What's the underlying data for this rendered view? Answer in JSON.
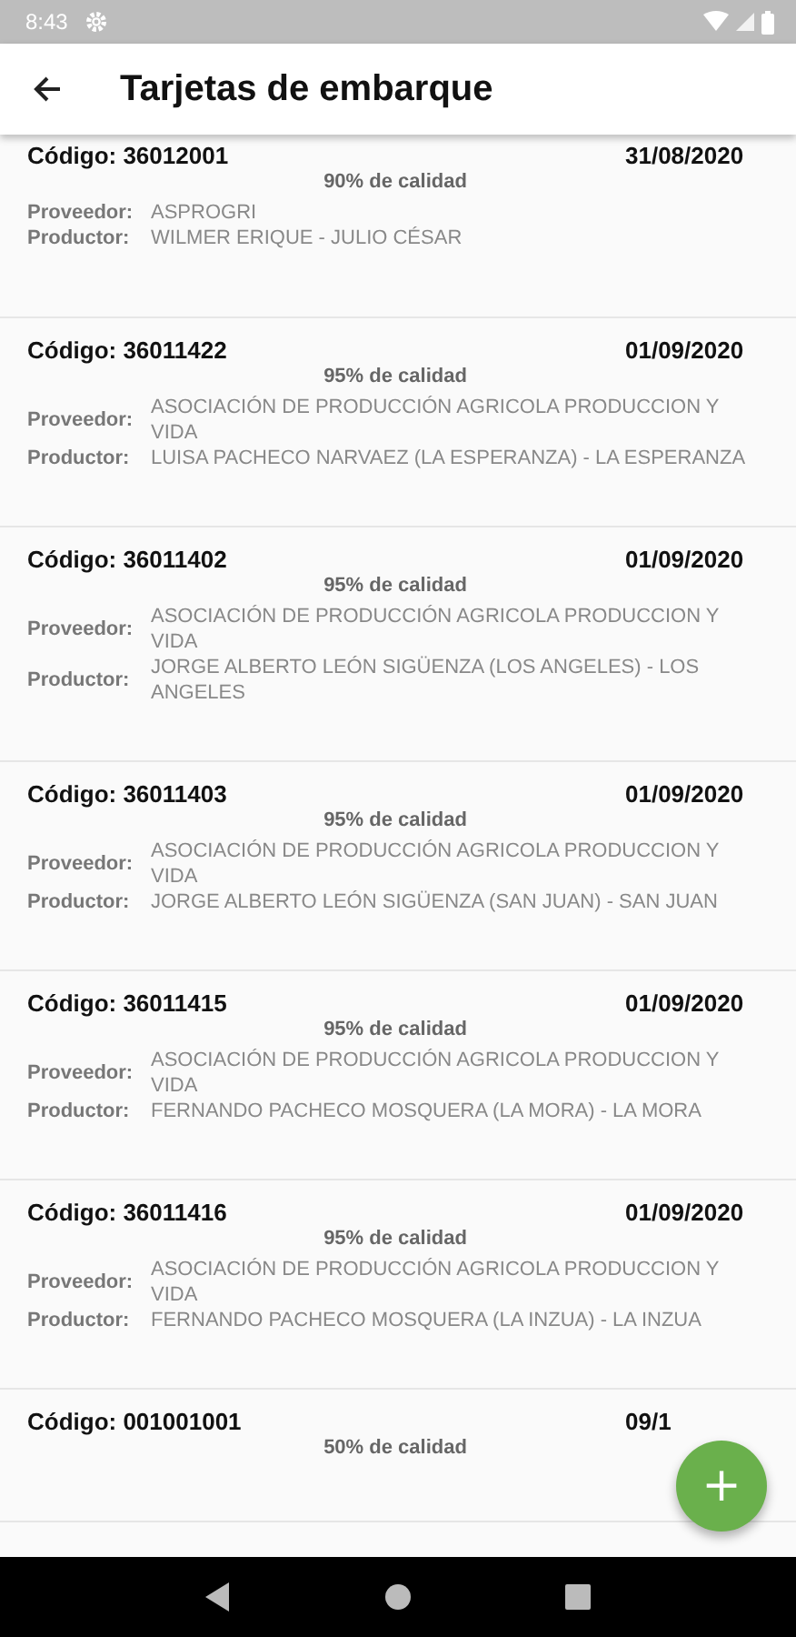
{
  "status_bar": {
    "time": "8:43"
  },
  "app_bar": {
    "title": "Tarjetas de embarque"
  },
  "cards": [
    {
      "code": "Código: 36012001",
      "date": "31/08/2020",
      "quality": "90% de calidad",
      "fields": [
        {
          "label": "Proveedor:",
          "value": "ASPROGRI"
        },
        {
          "label": "Productor:",
          "value": "WILMER ERIQUE - JULIO CÉSAR"
        }
      ]
    },
    {
      "code": "Código: 36011422",
      "date": "01/09/2020",
      "quality": "95% de calidad",
      "fields": [
        {
          "label": "Proveedor:",
          "value": "ASOCIACIÓN DE PRODUCCIÓN AGRICOLA PRODUCCION Y VIDA"
        },
        {
          "label": "Productor:",
          "value": "LUISA PACHECO NARVAEZ (LA ESPERANZA) - LA ESPERANZA"
        }
      ]
    },
    {
      "code": "Código: 36011402",
      "date": "01/09/2020",
      "quality": "95% de calidad",
      "fields": [
        {
          "label": "Proveedor:",
          "value": "ASOCIACIÓN DE PRODUCCIÓN AGRICOLA PRODUCCION Y VIDA"
        },
        {
          "label": "Productor:",
          "value": "JORGE ALBERTO LEÓN SIGÜENZA (LOS ANGELES) - LOS ANGELES"
        }
      ]
    },
    {
      "code": "Código: 36011403",
      "date": "01/09/2020",
      "quality": "95% de calidad",
      "fields": [
        {
          "label": "Proveedor:",
          "value": "ASOCIACIÓN DE PRODUCCIÓN AGRICOLA PRODUCCION Y VIDA"
        },
        {
          "label": "Productor:",
          "value": "JORGE ALBERTO LEÓN SIGÜENZA (SAN JUAN) - SAN JUAN"
        }
      ]
    },
    {
      "code": "Código: 36011415",
      "date": "01/09/2020",
      "quality": "95% de calidad",
      "fields": [
        {
          "label": "Proveedor:",
          "value": "ASOCIACIÓN DE PRODUCCIÓN AGRICOLA PRODUCCION Y VIDA"
        },
        {
          "label": "Productor:",
          "value": "FERNANDO PACHECO MOSQUERA (LA MORA) - LA MORA"
        }
      ]
    },
    {
      "code": "Código: 36011416",
      "date": "01/09/2020",
      "quality": "95% de calidad",
      "fields": [
        {
          "label": "Proveedor:",
          "value": "ASOCIACIÓN DE PRODUCCIÓN AGRICOLA PRODUCCION Y VIDA"
        },
        {
          "label": "Productor:",
          "value": "FERNANDO PACHECO MOSQUERA (LA INZUA) - LA INZUA"
        }
      ]
    },
    {
      "code": "Código: 001001001",
      "date": "09/1",
      "quality": "50% de calidad"
    }
  ],
  "fab": {
    "label": "+"
  }
}
